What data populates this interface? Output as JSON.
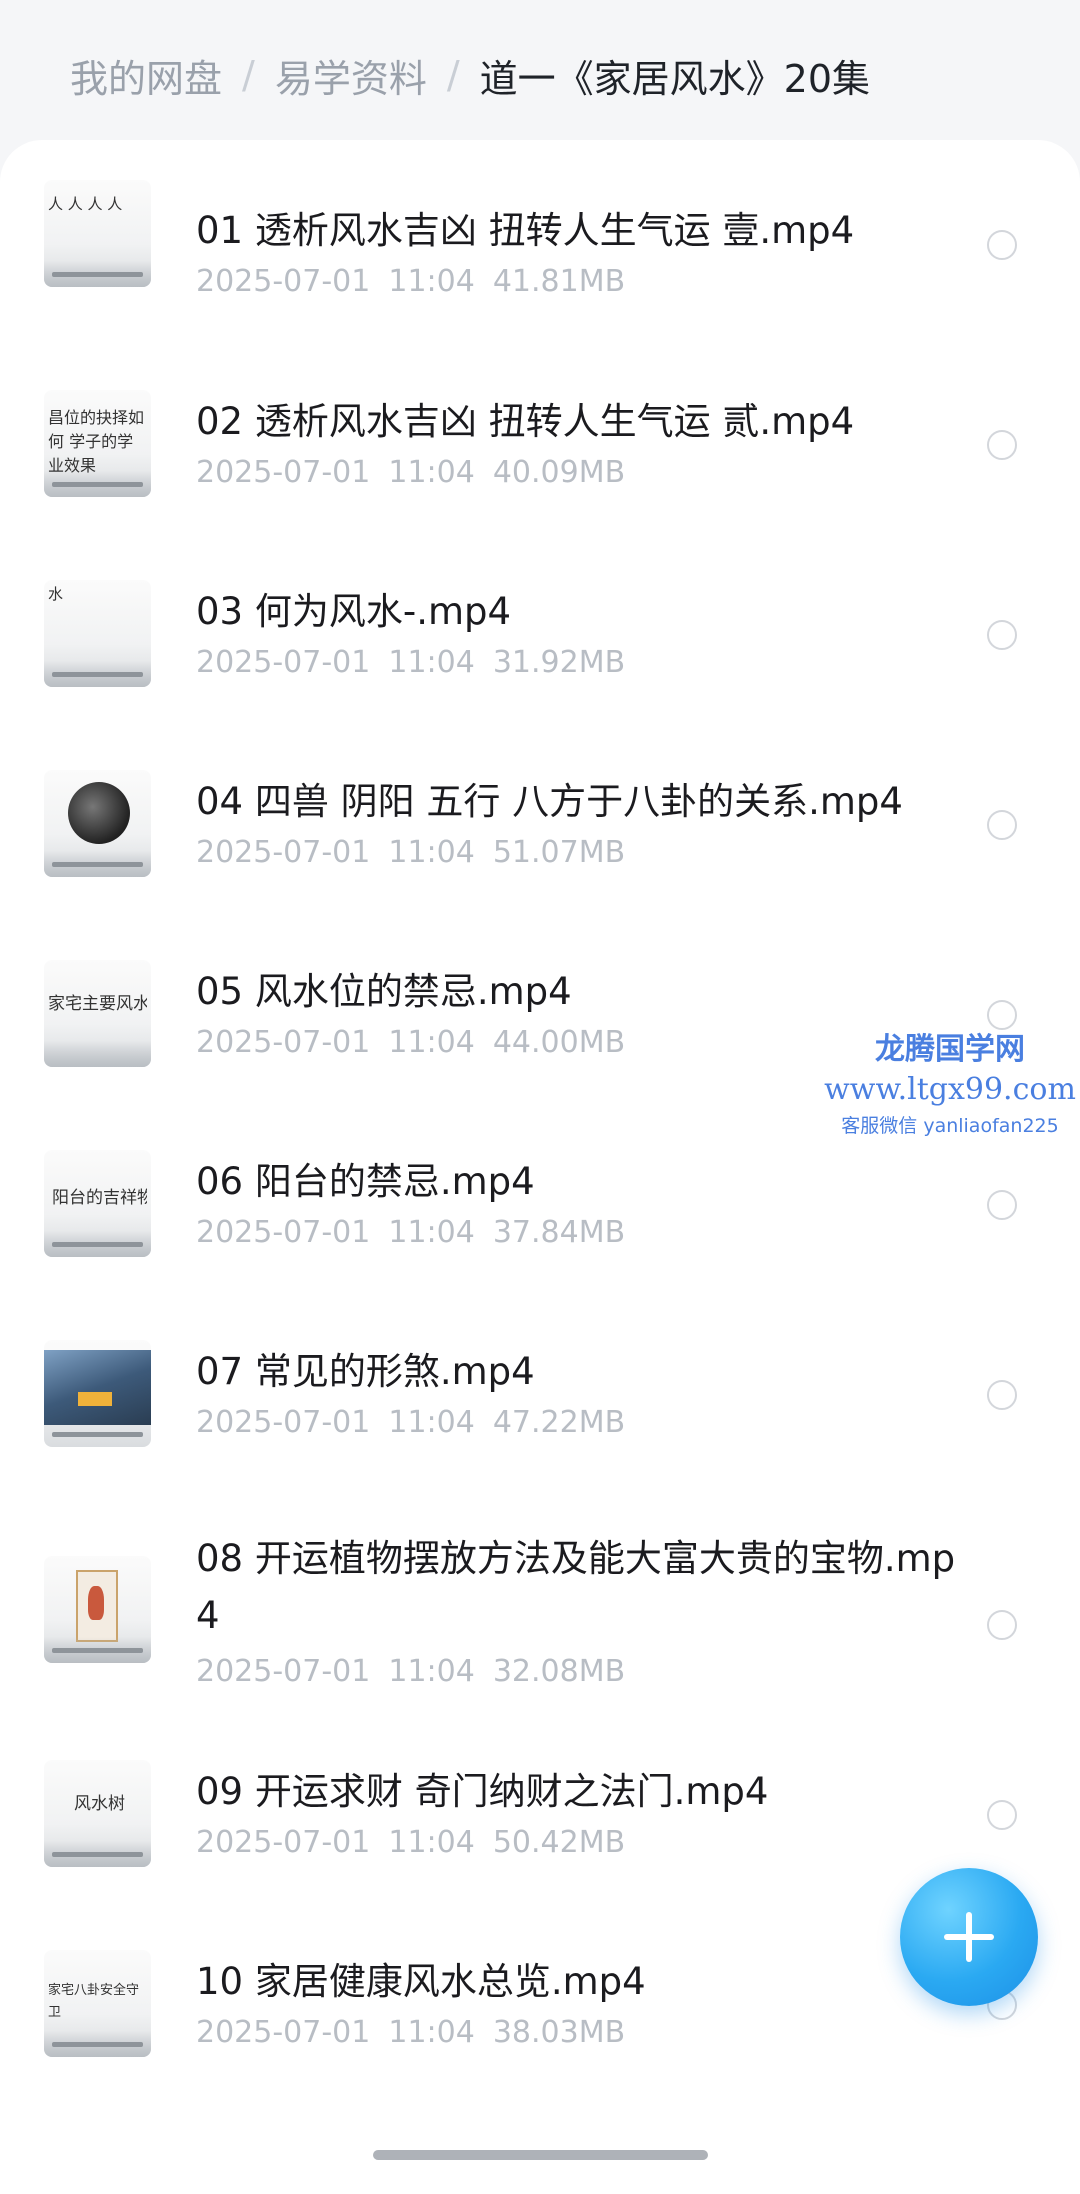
{
  "breadcrumb": {
    "root": "我的网盘",
    "separator": "/",
    "folder": "易学资料",
    "current": "道一《家居风水》20集"
  },
  "files": [
    {
      "name": "01 透析风水吉凶 扭转人生气运 壹.mp4",
      "date": "2025-07-01",
      "time": "11:04",
      "size": "41.81MB",
      "thumb_text": "人 人 人 人"
    },
    {
      "name": "02 透析风水吉凶 扭转人生气运 贰.mp4",
      "date": "2025-07-01",
      "time": "11:04",
      "size": "40.09MB",
      "thumb_text": "昌位的抉择如何 学子的学业效果"
    },
    {
      "name": "03 何为风水-.mp4",
      "date": "2025-07-01",
      "time": "11:04",
      "size": "31.92MB",
      "thumb_text": "水"
    },
    {
      "name": "04 四兽 阴阳 五行 八方于八卦的关系.mp4",
      "date": "2025-07-01",
      "time": "11:04",
      "size": "51.07MB",
      "thumb_text": ""
    },
    {
      "name": "05 风水位的禁忌.mp4",
      "date": "2025-07-01",
      "time": "11:04",
      "size": "44.00MB",
      "thumb_text": "家宅主要风水位"
    },
    {
      "name": "06 阳台的禁忌.mp4",
      "date": "2025-07-01",
      "time": "11:04",
      "size": "37.84MB",
      "thumb_text": "阳台的吉祥物"
    },
    {
      "name": "07 常见的形煞.mp4",
      "date": "2025-07-01",
      "time": "11:04",
      "size": "47.22MB",
      "thumb_text": ""
    },
    {
      "name": "08 开运植物摆放方法及能大富大贵的宝物.mp4",
      "date": "2025-07-01",
      "time": "11:04",
      "size": "32.08MB",
      "thumb_text": ""
    },
    {
      "name": "09 开运求财 奇门纳财之法门.mp4",
      "date": "2025-07-01",
      "time": "11:04",
      "size": "50.42MB",
      "thumb_text": "风水树"
    },
    {
      "name": "10 家居健康风水总览.mp4",
      "date": "2025-07-01",
      "time": "11:04",
      "size": "38.03MB",
      "thumb_text": "家宅八卦安全守卫"
    }
  ],
  "watermark": {
    "title": "龙腾国学网",
    "url": "www.ltgx99.com",
    "contact": "客服微信 yanliaofan225"
  },
  "fab": {
    "icon": "plus-icon"
  },
  "colors": {
    "accent": "#2aa9f2",
    "watermark": "#4a7fe0",
    "meta_text": "#b8bdc4",
    "breadcrumb_inactive": "#9aa1ab"
  }
}
